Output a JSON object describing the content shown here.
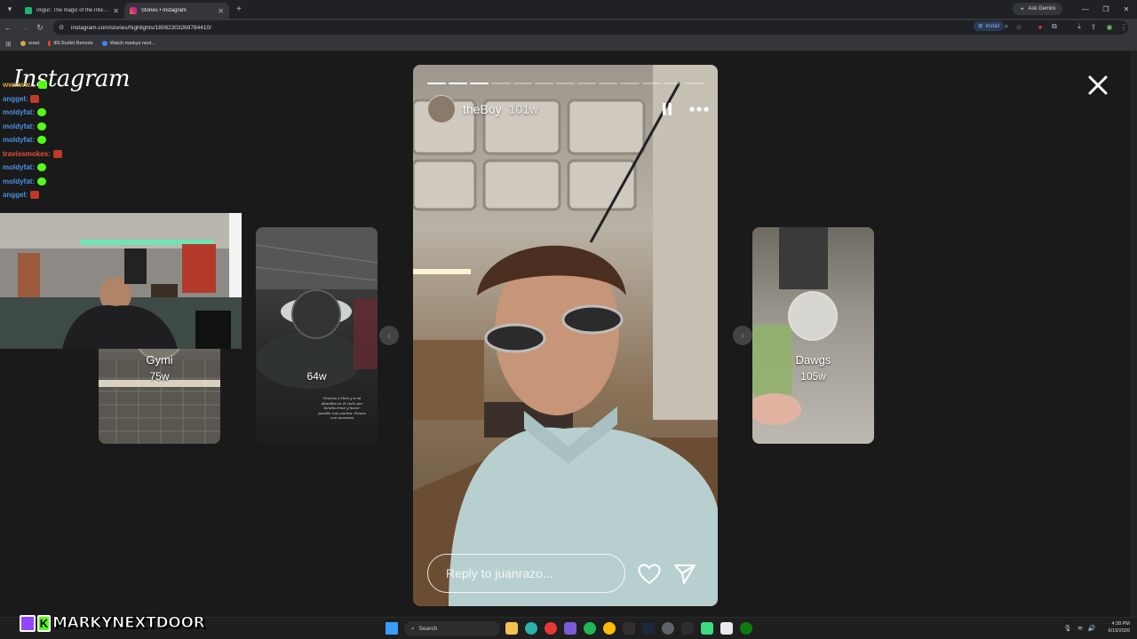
{
  "browser": {
    "tabs": [
      {
        "title": "Imgur: The magic of the Internet",
        "favicon_color": "#1bb76e",
        "active": false
      },
      {
        "title": "Stories • Instagram",
        "favicon_color": "#e1306c",
        "active": true
      }
    ],
    "new_tab_label": "+",
    "ask_gemini_label": "Ask Gemini",
    "url": "instagram.com/stories/highlights/18062303269784410/",
    "install_label": "Install",
    "bookmarks": [
      {
        "label": "rooet",
        "icon_color": "#d9a441"
      },
      {
        "label": "IRLToolkit Remote",
        "icon_color": "#e53935"
      },
      {
        "label": "Watch markys next...",
        "icon_color": "#4285f4"
      }
    ]
  },
  "instagram": {
    "logo": "Instagram",
    "close_icon": "close-icon"
  },
  "chat": {
    "lines": [
      {
        "user": "wwwww...",
        "color": "#d9a441",
        "emote_color": "#53fc18"
      },
      {
        "user": "anggel:",
        "color": "#4a90e2",
        "emote_color": "#c0392b"
      },
      {
        "user": "moldyfat:",
        "color": "#4a90e2",
        "emote_color": "#53fc18"
      },
      {
        "user": "moldyfat:",
        "color": "#4a90e2",
        "emote_color": "#53fc18"
      },
      {
        "user": "moldyfat:",
        "color": "#4a90e2",
        "emote_color": "#53fc18"
      },
      {
        "user": "travissmokes:",
        "color": "#e74c3c",
        "emote_color": "#c0392b"
      },
      {
        "user": "moldyfat:",
        "color": "#4a90e2",
        "emote_color": "#53fc18"
      },
      {
        "user": "moldyfat:",
        "color": "#4a90e2",
        "emote_color": "#53fc18"
      },
      {
        "user": "anggel:",
        "color": "#4a90e2",
        "emote_color": "#c0392b"
      }
    ]
  },
  "previews": [
    {
      "name": "Gymi",
      "age": "75w"
    },
    {
      "name": "",
      "age": "64w",
      "caption": "Gracias a Dios y a mi abuelita en el cielo por bendecirme y hacer posible mis sueños. Dimos con acciones"
    },
    {
      "name": "Dawgs",
      "age": "105w"
    }
  ],
  "story": {
    "username": "theBoy",
    "age": "101w",
    "progress_total": 13,
    "progress_done": 3,
    "reply_placeholder": "Reply to juanrazo..."
  },
  "twitch": {
    "channel": "MARKYNEXTDOOR",
    "badge": "K"
  },
  "taskbar": {
    "search_label": "Search",
    "time": "4:38 PM",
    "date": "6/19/2026"
  }
}
